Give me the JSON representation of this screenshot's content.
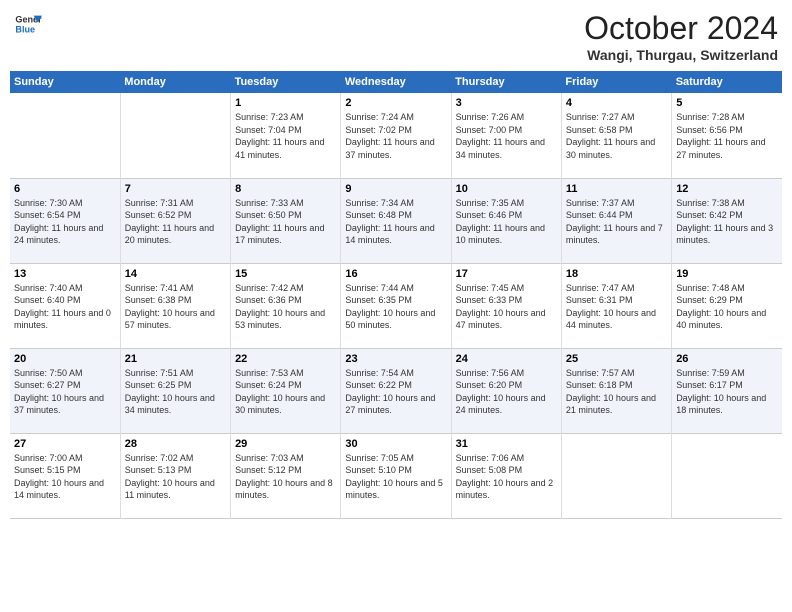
{
  "header": {
    "logo_line1": "General",
    "logo_line2": "Blue",
    "month": "October 2024",
    "location": "Wangi, Thurgau, Switzerland"
  },
  "weekdays": [
    "Sunday",
    "Monday",
    "Tuesday",
    "Wednesday",
    "Thursday",
    "Friday",
    "Saturday"
  ],
  "weeks": [
    [
      {
        "day": "",
        "info": ""
      },
      {
        "day": "",
        "info": ""
      },
      {
        "day": "1",
        "info": "Sunrise: 7:23 AM\nSunset: 7:04 PM\nDaylight: 11 hours and 41 minutes."
      },
      {
        "day": "2",
        "info": "Sunrise: 7:24 AM\nSunset: 7:02 PM\nDaylight: 11 hours and 37 minutes."
      },
      {
        "day": "3",
        "info": "Sunrise: 7:26 AM\nSunset: 7:00 PM\nDaylight: 11 hours and 34 minutes."
      },
      {
        "day": "4",
        "info": "Sunrise: 7:27 AM\nSunset: 6:58 PM\nDaylight: 11 hours and 30 minutes."
      },
      {
        "day": "5",
        "info": "Sunrise: 7:28 AM\nSunset: 6:56 PM\nDaylight: 11 hours and 27 minutes."
      }
    ],
    [
      {
        "day": "6",
        "info": "Sunrise: 7:30 AM\nSunset: 6:54 PM\nDaylight: 11 hours and 24 minutes."
      },
      {
        "day": "7",
        "info": "Sunrise: 7:31 AM\nSunset: 6:52 PM\nDaylight: 11 hours and 20 minutes."
      },
      {
        "day": "8",
        "info": "Sunrise: 7:33 AM\nSunset: 6:50 PM\nDaylight: 11 hours and 17 minutes."
      },
      {
        "day": "9",
        "info": "Sunrise: 7:34 AM\nSunset: 6:48 PM\nDaylight: 11 hours and 14 minutes."
      },
      {
        "day": "10",
        "info": "Sunrise: 7:35 AM\nSunset: 6:46 PM\nDaylight: 11 hours and 10 minutes."
      },
      {
        "day": "11",
        "info": "Sunrise: 7:37 AM\nSunset: 6:44 PM\nDaylight: 11 hours and 7 minutes."
      },
      {
        "day": "12",
        "info": "Sunrise: 7:38 AM\nSunset: 6:42 PM\nDaylight: 11 hours and 3 minutes."
      }
    ],
    [
      {
        "day": "13",
        "info": "Sunrise: 7:40 AM\nSunset: 6:40 PM\nDaylight: 11 hours and 0 minutes."
      },
      {
        "day": "14",
        "info": "Sunrise: 7:41 AM\nSunset: 6:38 PM\nDaylight: 10 hours and 57 minutes."
      },
      {
        "day": "15",
        "info": "Sunrise: 7:42 AM\nSunset: 6:36 PM\nDaylight: 10 hours and 53 minutes."
      },
      {
        "day": "16",
        "info": "Sunrise: 7:44 AM\nSunset: 6:35 PM\nDaylight: 10 hours and 50 minutes."
      },
      {
        "day": "17",
        "info": "Sunrise: 7:45 AM\nSunset: 6:33 PM\nDaylight: 10 hours and 47 minutes."
      },
      {
        "day": "18",
        "info": "Sunrise: 7:47 AM\nSunset: 6:31 PM\nDaylight: 10 hours and 44 minutes."
      },
      {
        "day": "19",
        "info": "Sunrise: 7:48 AM\nSunset: 6:29 PM\nDaylight: 10 hours and 40 minutes."
      }
    ],
    [
      {
        "day": "20",
        "info": "Sunrise: 7:50 AM\nSunset: 6:27 PM\nDaylight: 10 hours and 37 minutes."
      },
      {
        "day": "21",
        "info": "Sunrise: 7:51 AM\nSunset: 6:25 PM\nDaylight: 10 hours and 34 minutes."
      },
      {
        "day": "22",
        "info": "Sunrise: 7:53 AM\nSunset: 6:24 PM\nDaylight: 10 hours and 30 minutes."
      },
      {
        "day": "23",
        "info": "Sunrise: 7:54 AM\nSunset: 6:22 PM\nDaylight: 10 hours and 27 minutes."
      },
      {
        "day": "24",
        "info": "Sunrise: 7:56 AM\nSunset: 6:20 PM\nDaylight: 10 hours and 24 minutes."
      },
      {
        "day": "25",
        "info": "Sunrise: 7:57 AM\nSunset: 6:18 PM\nDaylight: 10 hours and 21 minutes."
      },
      {
        "day": "26",
        "info": "Sunrise: 7:59 AM\nSunset: 6:17 PM\nDaylight: 10 hours and 18 minutes."
      }
    ],
    [
      {
        "day": "27",
        "info": "Sunrise: 7:00 AM\nSunset: 5:15 PM\nDaylight: 10 hours and 14 minutes."
      },
      {
        "day": "28",
        "info": "Sunrise: 7:02 AM\nSunset: 5:13 PM\nDaylight: 10 hours and 11 minutes."
      },
      {
        "day": "29",
        "info": "Sunrise: 7:03 AM\nSunset: 5:12 PM\nDaylight: 10 hours and 8 minutes."
      },
      {
        "day": "30",
        "info": "Sunrise: 7:05 AM\nSunset: 5:10 PM\nDaylight: 10 hours and 5 minutes."
      },
      {
        "day": "31",
        "info": "Sunrise: 7:06 AM\nSunset: 5:08 PM\nDaylight: 10 hours and 2 minutes."
      },
      {
        "day": "",
        "info": ""
      },
      {
        "day": "",
        "info": ""
      }
    ]
  ]
}
